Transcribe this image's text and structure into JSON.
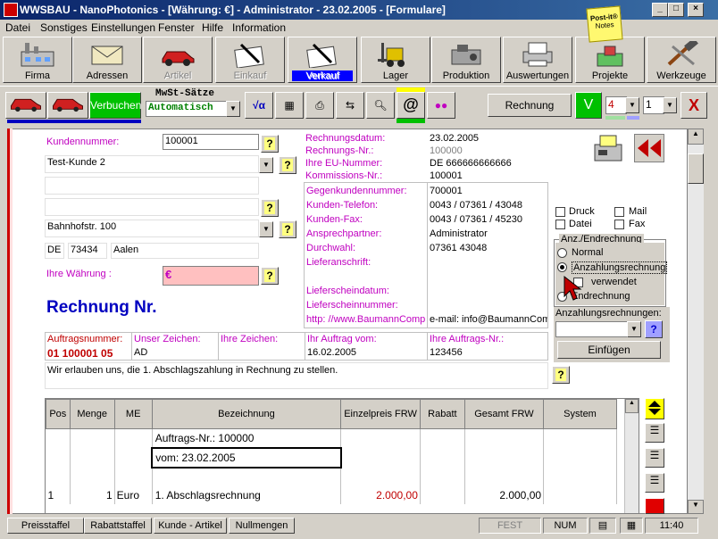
{
  "window": {
    "title": "WWSBAU - NanoPhotonics - [Währung: €] - Administrator - 23.02.2005 - [Formulare]"
  },
  "menu": [
    {
      "label": "Datei"
    },
    {
      "label": "Sonstiges"
    },
    {
      "label": "Einstellungen"
    },
    {
      "label": "Fenster"
    },
    {
      "label": "Hilfe"
    },
    {
      "label": "Information"
    }
  ],
  "toolbar": [
    {
      "label": "Firma",
      "icon": "factory-icon"
    },
    {
      "label": "Adressen",
      "icon": "envelope-icon"
    },
    {
      "label": "Artikel",
      "icon": "car-icon"
    },
    {
      "label": "Einkauf",
      "icon": "writing-hand-icon"
    },
    {
      "label": "Verkauf",
      "icon": "writing-hand-icon"
    },
    {
      "label": "Lager",
      "icon": "forklift-icon"
    },
    {
      "label": "Produktion",
      "icon": "machine-icon"
    },
    {
      "label": "Auswertungen",
      "icon": "printer-icon"
    },
    {
      "label": "Projekte",
      "icon": "project-icon"
    },
    {
      "label": "Werkzeuge",
      "icon": "tools-icon"
    }
  ],
  "postit": {
    "line1": "Post-it®",
    "line2": "Notes"
  },
  "subtoolbar": {
    "verbuchen": "Verbuchen",
    "mwst_label": "MwSt-Sätze",
    "mwst_value": "Automatisch",
    "rechnung": "Rechnung",
    "v": "V",
    "copies": "4",
    "page": "1",
    "close": "X",
    "sqrt": "√α",
    "at": "@"
  },
  "customer": {
    "nr_label": "Kundennummer:",
    "nr": "100001",
    "name": "Test-Kunde 2",
    "street": "Bahnhofstr. 100",
    "country": "DE",
    "zip": "73434",
    "city": "Aalen",
    "currency_label": "Ihre Währung :",
    "currency": "€"
  },
  "invoice": {
    "heading": "Rechnung  Nr.",
    "rows": [
      {
        "label": "Rechnungsdatum:",
        "value": "23.02.2005"
      },
      {
        "label": "Rechnungs-Nr.:",
        "value": "100000"
      },
      {
        "label": "Ihre EU-Nummer:",
        "value": "DE 666666666666"
      },
      {
        "label": "Kommissions-Nr.:",
        "value": "100001"
      }
    ],
    "rows2": [
      {
        "label": "Gegenkundennummer:",
        "value": "700001"
      },
      {
        "label": "Kunden-Telefon:",
        "value": "0043 / 07361 / 43048"
      },
      {
        "label": "Kunden-Fax:",
        "value": "0043 / 07361 / 45230"
      },
      {
        "label": "Ansprechpartner:",
        "value": "Administrator"
      },
      {
        "label": "Durchwahl:",
        "value": "07361 43048"
      },
      {
        "label": "Lieferanschrift:",
        "value": ""
      },
      {
        "label": "",
        "value": ""
      },
      {
        "label": "Lieferscheindatum:",
        "value": ""
      },
      {
        "label": "Lieferscheinnummer:",
        "value": ""
      }
    ],
    "url": "http: //www.BaumannComp",
    "email": "e-mail: info@BaumannComp"
  },
  "options": {
    "druck": "Druck",
    "mail": "Mail",
    "datei": "Datei",
    "fax": "Fax",
    "group_label": "Anz./Endrechnung",
    "normal": "Normal",
    "anzahlung": "Anzahlungsrechnung",
    "verwendet": "verwendet",
    "end": "Endrechnung",
    "anz_label": "Anzahlungsrechnungen:",
    "einfuegen": "Einfügen",
    "help": "?"
  },
  "order": {
    "headers": [
      "Auftragsnummer:",
      "Unser Zeichen:",
      "Ihre Zeichen:",
      "Ihr Auftrag vom:",
      "Ihre Auftrags-Nr.:"
    ],
    "values": [
      "01 100001 05",
      "AD",
      "",
      "16.02.2005",
      "123456"
    ],
    "text": "Wir erlauben uns, die 1. Abschlagszahlung in Rechnung zu stellen."
  },
  "grid": {
    "headers": [
      "Pos",
      "Menge",
      "ME",
      "Bezeichnung",
      "Einzelpreis FRW",
      "Rabatt",
      "Gesamt FRW",
      "System"
    ],
    "line_a": "Auftrags-Nr.: 100000",
    "line_b": "vom:  23.02.2005",
    "item": {
      "pos": "1",
      "menge": "1",
      "me": "Euro",
      "bez": "1. Abschlagsrechnung",
      "preis": "2.000,00",
      "gesamt": "2.000,00"
    }
  },
  "statusbar": {
    "b1": "Preisstaffel",
    "b2": "Rabattstaffel",
    "b3": "Kunde - Artikel",
    "b4": "Nullmengen",
    "fest": "FEST",
    "num": "NUM",
    "time": "11:40"
  },
  "colors": {
    "accent": "#0000ff",
    "label": "#c000c0",
    "verbuchen": "#00c000"
  }
}
